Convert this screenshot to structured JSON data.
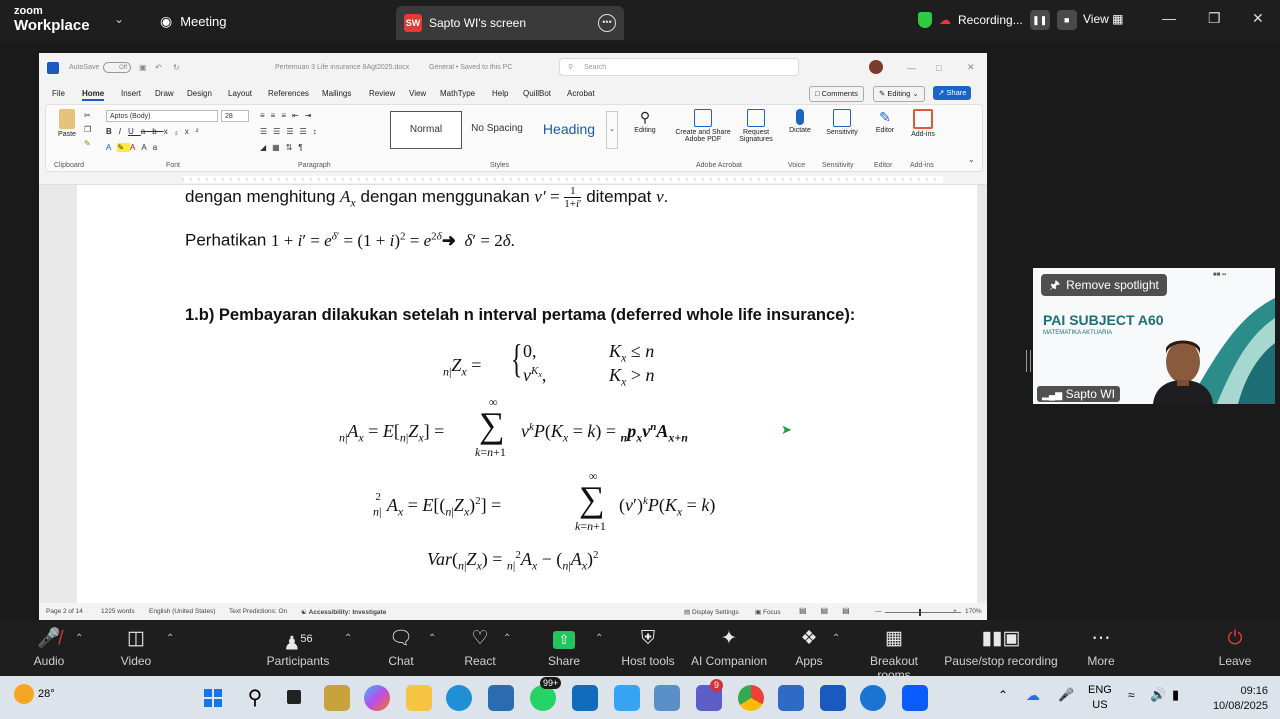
{
  "zoom": {
    "brand_small": "zoom",
    "brand_big": "Workplace",
    "meeting_label": "Meeting",
    "screen_tab_initials": "SW",
    "screen_tab_label": "Sapto WI's screen",
    "recording_label": "Recording...",
    "view_label": "View",
    "toolbar": {
      "audio": "Audio",
      "video": "Video",
      "participants": "Participants",
      "participants_count": "56",
      "chat": "Chat",
      "react": "React",
      "share": "Share",
      "host_tools": "Host tools",
      "ai_companion": "AI Companion",
      "apps": "Apps",
      "breakout": "Breakout rooms",
      "pause_recording": "Pause/stop recording",
      "more": "More",
      "leave": "Leave"
    },
    "spotlight": {
      "remove_label": "Remove spotlight",
      "slide_title": "PAI SUBJECT A60",
      "slide_subtitle": "MATEMATIKA AKTUARIA",
      "participant_name": "Sapto WI"
    }
  },
  "word": {
    "autosave": "AutoSave",
    "autosave_state": "Off",
    "doc_title": "Pertemuan 3 Life insurance 8Agt2025.docx",
    "saved_state": "General • Saved to this PC",
    "search_placeholder": "Search",
    "tabs": [
      "File",
      "Home",
      "Insert",
      "Draw",
      "Design",
      "Layout",
      "References",
      "Mailings",
      "Review",
      "View",
      "MathType",
      "Help",
      "QuillBot",
      "Acrobat"
    ],
    "active_tab": "Home",
    "comments": "Comments",
    "editing": "Editing",
    "share": "Share",
    "font_name": "Aptos (Body)",
    "font_size": "28",
    "ribbon": {
      "paste": "Paste",
      "clipboard": "Clipboard",
      "font": "Font",
      "paragraph": "Paragraph",
      "styles": "Styles",
      "style_normal": "Normal",
      "style_nospacing": "No Spacing",
      "style_heading": "Heading",
      "editing_btn": "Editing",
      "create_pdf": "Create and Share Adobe PDF",
      "request_sig": "Request Signatures",
      "adobe_group": "Adobe Acrobat",
      "dictate": "Dictate",
      "voice": "Voice",
      "sensitivity": "Sensitivity",
      "editor": "Editor",
      "addins": "Add-ins"
    },
    "status": {
      "page": "Page 2 of 14",
      "words": "1225 words",
      "language": "English (United States)",
      "predictions": "Text Predictions: On",
      "accessibility": "Accessibility: Investigate",
      "display": "Display Settings",
      "focus": "Focus",
      "zoom": "170%"
    },
    "document": {
      "line1_a": "dengan menghitung",
      "line1_b": "dengan menggunakan",
      "line1_c": "ditempat",
      "line2": "Perhatikan",
      "heading": "1.b) Pembayaran dilakukan setelah n interval pertama (deferred whole life insurance):"
    }
  },
  "taskbar": {
    "weather": "28°",
    "lang1": "ENG",
    "lang2": "US",
    "time": "09:16",
    "date": "10/08/2025",
    "badge_whatsapp": "99+",
    "badge_teams": "9"
  }
}
